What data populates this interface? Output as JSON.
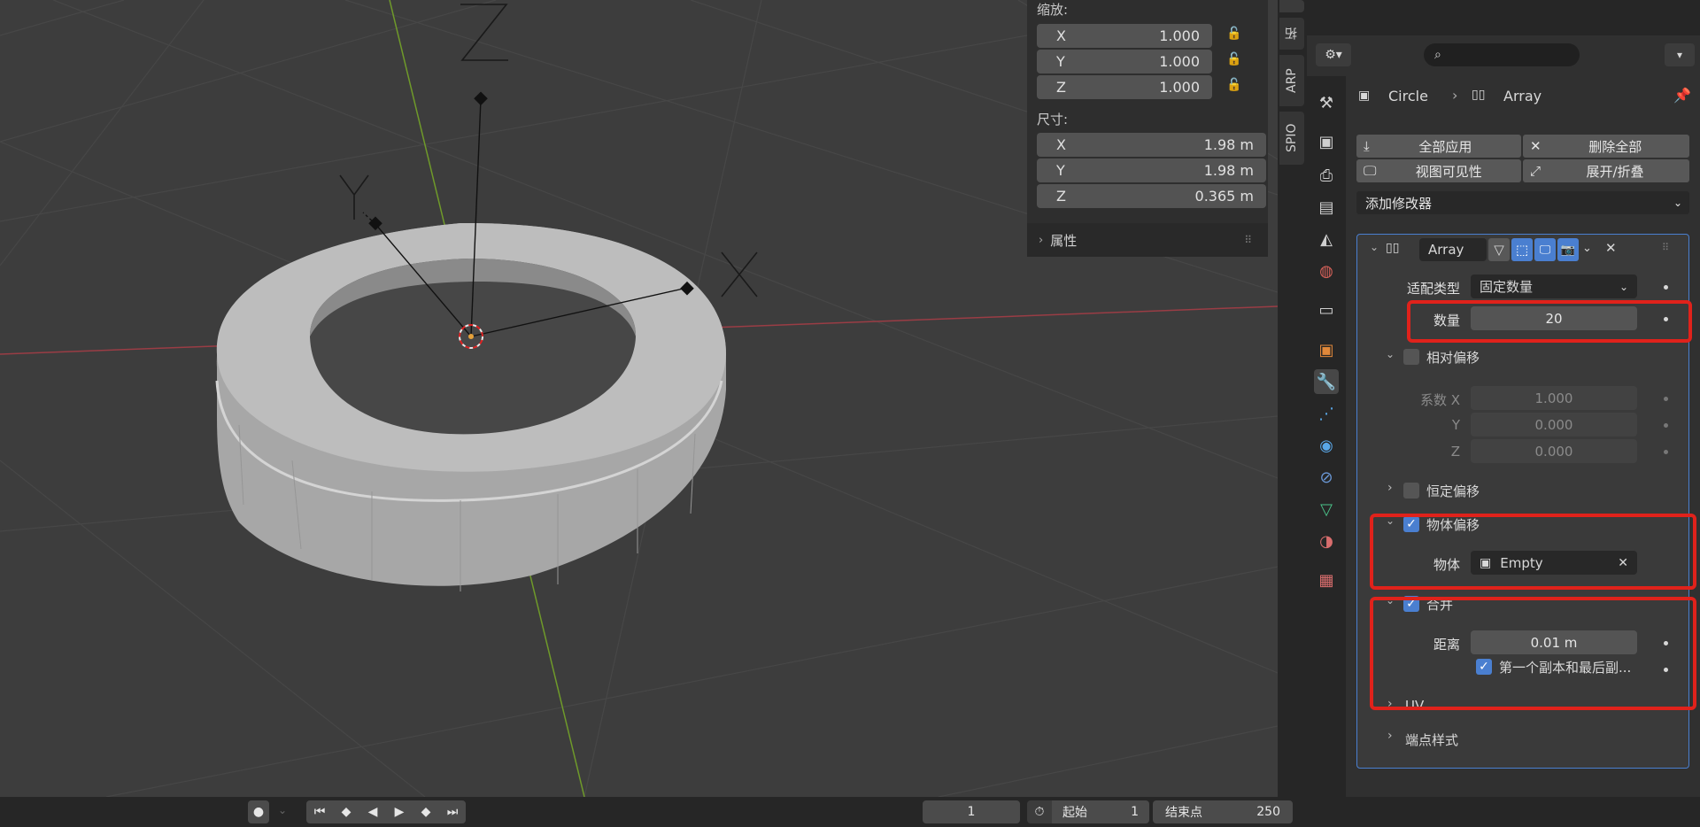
{
  "viewport": {
    "axis_x": "X",
    "axis_y": "Y",
    "axis_z": "Z"
  },
  "npanel": {
    "scale_label": "缩放:",
    "scale": [
      {
        "axis": "X",
        "value": "1.000"
      },
      {
        "axis": "Y",
        "value": "1.000"
      },
      {
        "axis": "Z",
        "value": "1.000"
      }
    ],
    "dimensions_label": "尺寸:",
    "dimensions": [
      {
        "axis": "X",
        "value": "1.98 m"
      },
      {
        "axis": "Y",
        "value": "1.98 m"
      },
      {
        "axis": "Z",
        "value": "0.365 m"
      }
    ],
    "properties_label": "属性"
  },
  "side_tabs": [
    "拓",
    "ARP",
    "SPIO"
  ],
  "properties": {
    "breadcrumb_object": "Circle",
    "breadcrumb_modifier": "Array",
    "apply_all": "全部应用",
    "delete_all": "删除全部",
    "viewport_visibility": "视图可见性",
    "expand_collapse": "展开/折叠",
    "add_modifier": "添加修改器",
    "modifier": {
      "name": "Array",
      "fit_type_label": "适配类型",
      "fit_type_value": "固定数量",
      "count_label": "数量",
      "count_value": "20",
      "relative_offset_label": "相对偏移",
      "factor_x_label": "系数 X",
      "factor_x_value": "1.000",
      "factor_y_label": "Y",
      "factor_y_value": "0.000",
      "factor_z_label": "Z",
      "factor_z_value": "0.000",
      "constant_offset_label": "恒定偏移",
      "object_offset_label": "物体偏移",
      "object_label": "物体",
      "object_value": "Empty",
      "merge_label": "合并",
      "distance_label": "距离",
      "distance_value": "0.01 m",
      "first_last_label": "第一个副本和最后副...",
      "uv_label": "UV",
      "caps_label": "端点样式"
    }
  },
  "timeline": {
    "current_frame": "1",
    "start_label": "起始",
    "start_value": "1",
    "end_label": "结束点",
    "end_value": "250"
  },
  "colors": {
    "accent": "#4a7fd0",
    "highlight_box": "#e0221b"
  }
}
